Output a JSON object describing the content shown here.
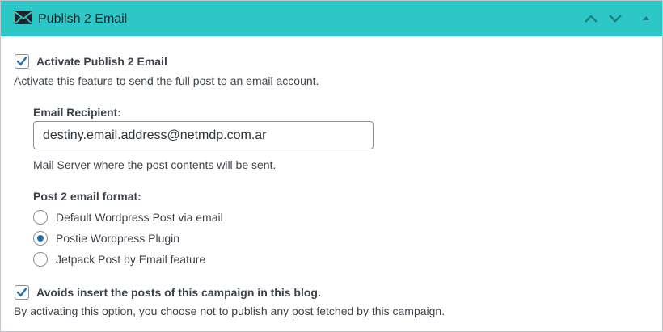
{
  "header": {
    "title": "Publish 2 Email",
    "icon": "mail-icon",
    "move_up_icon": "chevron-up-icon",
    "move_down_icon": "chevron-down-icon",
    "toggle_icon": "triangle-up-icon",
    "background": "#2ec7c8"
  },
  "activate": {
    "checked": true,
    "label": "Activate Publish 2 Email",
    "description": "Activate this feature to send the full post to an email account."
  },
  "recipient": {
    "label": "Email Recipient:",
    "value": "destiny.email.address@netmdp.com.ar",
    "help": "Mail Server where the post contents will be sent."
  },
  "format": {
    "label": "Post 2 email format:",
    "options": [
      {
        "label": "Default Wordpress Post via email",
        "checked": false
      },
      {
        "label": "Postie Wordpress Plugin",
        "checked": true
      },
      {
        "label": "Jetpack Post by Email feature",
        "checked": false
      }
    ]
  },
  "avoid_insert": {
    "checked": true,
    "label": "Avoids insert the posts of this campaign in this blog.",
    "description": "By activating this option, you choose not to publish any post fetched by this campaign."
  },
  "colors": {
    "accent": "#2271b1",
    "text": "#3c434a"
  }
}
